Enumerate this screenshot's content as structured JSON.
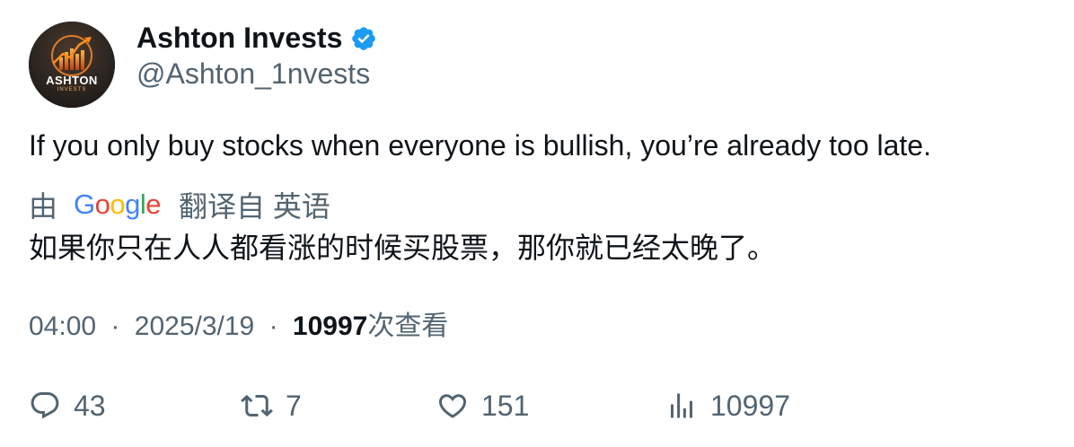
{
  "author": {
    "name": "Ashton Invests",
    "handle": "@Ashton_1nvests",
    "avatar_text": "ASHTON",
    "avatar_subtext": "INVESTS",
    "verified": true
  },
  "tweet": {
    "text": "If you only buy stocks when everyone is bullish, you’re already too late.",
    "translation": {
      "prefix": "由",
      "provider": "Google",
      "suffix": "翻译自 英语",
      "text": "如果你只在人人都看涨的时候买股票，那你就已经太晚了。"
    },
    "time": "04:00",
    "separator": "·",
    "date": "2025/3/19",
    "views_count": "10997",
    "views_label": "次查看"
  },
  "actions": {
    "replies": "43",
    "retweets": "7",
    "likes": "151",
    "views": "10997"
  },
  "colors": {
    "verified": "#1d9bf0",
    "muted": "#536471",
    "text": "#0f1419"
  }
}
